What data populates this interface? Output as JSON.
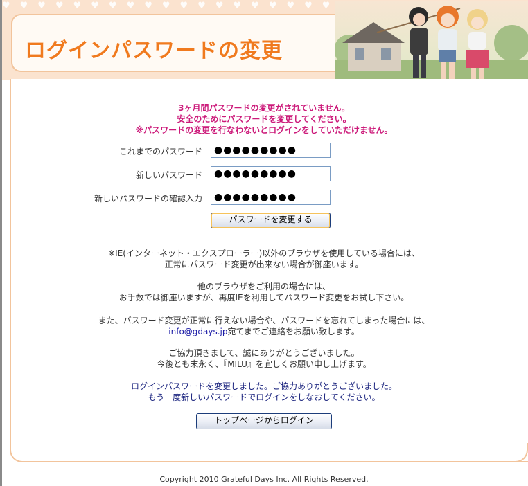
{
  "header": {
    "title": "ログインパスワードの変更"
  },
  "warning": {
    "line1": "3ヶ月間パスワードの変更がされていません。",
    "line2": "安全のためにパスワードを変更してください。",
    "line3": "※パスワードの変更を行なわないとログインをしていただけません。"
  },
  "form": {
    "current_label": "これまでのパスワード",
    "current_value": "●●●●●●●●●",
    "new_label": "新しいパスワード",
    "new_value": "●●●●●●●●●",
    "confirm_label": "新しいパスワードの確認入力",
    "confirm_value": "●●●●●●●●●",
    "submit_label": "パスワードを変更する"
  },
  "notice": {
    "p1_line1": "※IE(インターネット・エクスプローラー)以外のブラウザを使用している場合には、",
    "p1_line2": "正常にパスワード変更が出来ない場合が御座います。",
    "p2_line1": "他のブラウザをご利用の場合には、",
    "p2_line2": "お手数では御座いますが、再度IEを利用してパスワード変更をお試し下さい。",
    "p3_line1": "また、パスワード変更が正常に行えない場合や、パスワードを忘れてしまった場合には、",
    "p3_email": "info@gdays.jp",
    "p3_line2_rest": "宛てまでご連絡をお願い致します。",
    "p4_line1": "ご協力頂きまして、誠にありがとうございました。",
    "p4_line2": "今後とも末永く、『MILU』を宜しくお願い申し上げます。"
  },
  "complete": {
    "line1": "ログインパスワードを変更しました。ご協力ありがとうございました。",
    "line2": "もう一度新しいパスワードでログインをしなおしてください。",
    "top_login_label": "トップページからログイン"
  },
  "footer": {
    "copyright": "Copyright 2010 Grateful Days Inc. All Rights Reserved."
  },
  "colors": {
    "title": "#f07a1e",
    "warning": "#cc1a7a",
    "complete": "#1a237e",
    "border": "#f2c49c",
    "band": "#fbe3cf"
  }
}
